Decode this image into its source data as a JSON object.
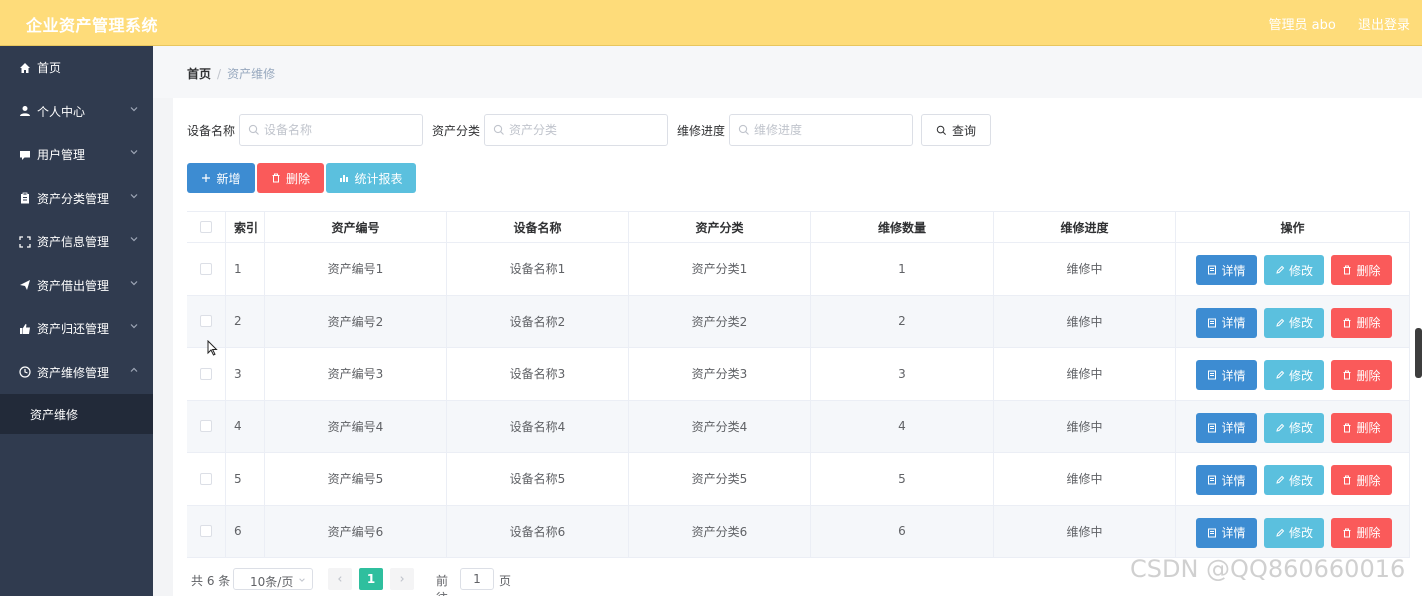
{
  "header": {
    "app_title": "企业资产管理系统",
    "user_label": "管理员 abo",
    "logout_label": "退出登录"
  },
  "colors": {
    "topbar": "#fedc7a",
    "sidebar": "#303b4f",
    "submenu": "#222a39",
    "primary": "#3d8cd2",
    "info": "#5bc0de",
    "danger": "#fa5a5a",
    "pager_active": "#2fbf9e"
  },
  "sidebar": {
    "items": [
      {
        "label": "首页",
        "icon": "home-icon"
      },
      {
        "label": "个人中心",
        "icon": "user-icon"
      },
      {
        "label": "用户管理",
        "icon": "chat-icon"
      },
      {
        "label": "资产分类管理",
        "icon": "clipboard-icon"
      },
      {
        "label": "资产信息管理",
        "icon": "frame-icon"
      },
      {
        "label": "资产借出管理",
        "icon": "send-icon"
      },
      {
        "label": "资产归还管理",
        "icon": "thumb-icon"
      },
      {
        "label": "资产维修管理",
        "icon": "clock-icon"
      }
    ],
    "sub_active": "资产维修"
  },
  "breadcrumb": {
    "home": "首页",
    "separator": "/",
    "current": "资产维修"
  },
  "search": {
    "fields": [
      {
        "label": "设备名称",
        "placeholder": "设备名称"
      },
      {
        "label": "资产分类",
        "placeholder": "资产分类"
      },
      {
        "label": "维修进度",
        "placeholder": "维修进度"
      }
    ],
    "query_label": "查询"
  },
  "toolbar": {
    "add_label": "新增",
    "delete_label": "删除",
    "report_label": "统计报表"
  },
  "table": {
    "columns": [
      "索引",
      "资产编号",
      "设备名称",
      "资产分类",
      "维修数量",
      "维修进度",
      "操作"
    ],
    "rows": [
      {
        "index": "1",
        "asset_no": "资产编号1",
        "device": "设备名称1",
        "category": "资产分类1",
        "qty": "1",
        "progress": "维修中"
      },
      {
        "index": "2",
        "asset_no": "资产编号2",
        "device": "设备名称2",
        "category": "资产分类2",
        "qty": "2",
        "progress": "维修中"
      },
      {
        "index": "3",
        "asset_no": "资产编号3",
        "device": "设备名称3",
        "category": "资产分类3",
        "qty": "3",
        "progress": "维修中"
      },
      {
        "index": "4",
        "asset_no": "资产编号4",
        "device": "设备名称4",
        "category": "资产分类4",
        "qty": "4",
        "progress": "维修中"
      },
      {
        "index": "5",
        "asset_no": "资产编号5",
        "device": "设备名称5",
        "category": "资产分类5",
        "qty": "5",
        "progress": "维修中"
      },
      {
        "index": "6",
        "asset_no": "资产编号6",
        "device": "设备名称6",
        "category": "资产分类6",
        "qty": "6",
        "progress": "维修中"
      }
    ],
    "actions": {
      "detail": "详情",
      "edit": "修改",
      "delete": "删除"
    }
  },
  "pagination": {
    "total_text": "共 6 条",
    "page_size": "10条/页",
    "current_page": "1",
    "goto_label": "前往",
    "goto_value": "1",
    "page_suffix": "页"
  },
  "watermark": "CSDN @QQ860660016"
}
